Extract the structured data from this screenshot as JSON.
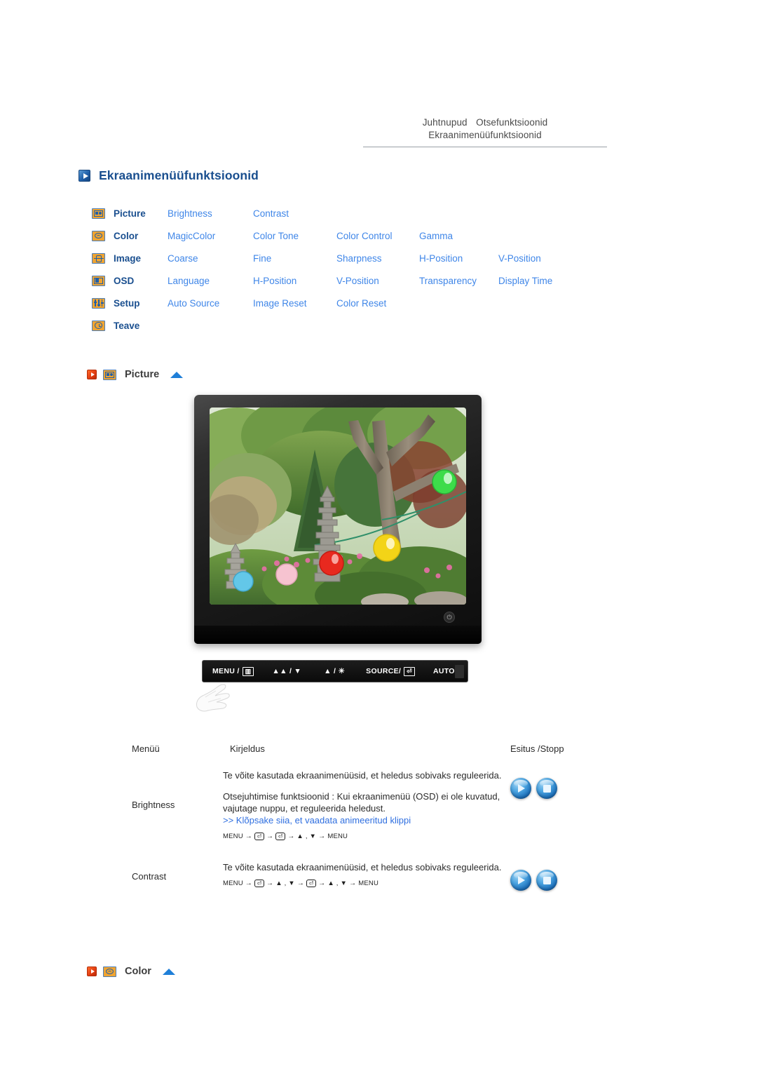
{
  "topnav": {
    "items": [
      "Juhtnupud",
      "Otsefunktsioonid",
      "Ekraanimenüüfunktsioonid"
    ]
  },
  "page": {
    "title": "Ekraanimenüüfunktsioonid",
    "title_icon": "play-square-icon"
  },
  "menu_matrix": {
    "rows": [
      {
        "icon": "picture-icon",
        "name": "Picture",
        "items": [
          "Brightness",
          "Contrast",
          "",
          "",
          ""
        ]
      },
      {
        "icon": "color-wheel-icon",
        "name": "Color",
        "items": [
          "MagicColor",
          "Color Tone",
          "Color Control",
          "Gamma",
          ""
        ]
      },
      {
        "icon": "image-icon",
        "name": "Image",
        "items": [
          "Coarse",
          "Fine",
          "Sharpness",
          "H-Position",
          "V-Position"
        ]
      },
      {
        "icon": "osd-icon",
        "name": "OSD",
        "items": [
          "Language",
          "H-Position",
          "V-Position",
          "Transparency",
          "Display Time"
        ]
      },
      {
        "icon": "setup-icon",
        "name": "Setup",
        "items": [
          "Auto Source",
          "Image Reset",
          "Color Reset",
          "",
          ""
        ]
      },
      {
        "icon": "clock-icon",
        "name": "Teave",
        "items": [
          "",
          "",
          "",
          "",
          ""
        ]
      }
    ]
  },
  "sections": {
    "picture": {
      "label": "Picture",
      "icon": "picture-icon",
      "marker_icon": "red-play-icon",
      "collapse_icon": "up-triangle-icon"
    },
    "color": {
      "label": "Color",
      "icon": "color-wheel-icon",
      "marker_icon": "red-play-icon",
      "collapse_icon": "up-triangle-icon"
    }
  },
  "monitor": {
    "screen_alt": "garden-photo-with-stone-pagoda-and-lanterns",
    "power_glyph": "⏻",
    "controls": [
      {
        "label": "MENU /",
        "glyph": "▥"
      },
      {
        "label": "",
        "glyph": "▲▲ / ▼"
      },
      {
        "label": "",
        "glyph": "▲ / ☀"
      },
      {
        "label": "SOURCE/",
        "glyph": "⏎"
      },
      {
        "label": "AUTO",
        "glyph": ""
      },
      {
        "label": "",
        "glyph": "⏻"
      }
    ]
  },
  "table": {
    "headers": {
      "menu": "Menüü",
      "description": "Kirjeldus",
      "play": "Esitus /Stopp"
    },
    "rows": [
      {
        "menu": "Brightness",
        "paragraphs": [
          "Te võite kasutada ekraanimenüüsid, et heledus sobivaks reguleerida.",
          "Otsejuhtimise funktsioonid : Kui ekraanimenüü (OSD) ei ole kuvatud, vajutage nuppu, et reguleerida heledust."
        ],
        "link": ">> Klõpsake siia, et vaadata animeeritud klippi",
        "sequence": [
          "MENU",
          "→",
          "⏎",
          "→",
          "⏎",
          "→",
          "▲ , ▼",
          "→",
          "MENU"
        ],
        "play_label": "play-button",
        "stop_label": "stop-button"
      },
      {
        "menu": "Contrast",
        "paragraphs": [
          "Te võite kasutada ekraanimenüüsid, et heledus sobivaks reguleerida."
        ],
        "link": "",
        "sequence": [
          "MENU",
          "→",
          "⏎",
          "→",
          "▲ , ▼",
          "→",
          "⏎",
          "→",
          "▲ , ▼",
          "→",
          "MENU"
        ],
        "play_label": "play-button",
        "stop_label": "stop-button"
      }
    ]
  },
  "colors": {
    "title_blue": "#1a4f8f",
    "link_blue": "#3f86e8",
    "icon_orange": "#f0a431",
    "red_marker": "#e03a10"
  }
}
